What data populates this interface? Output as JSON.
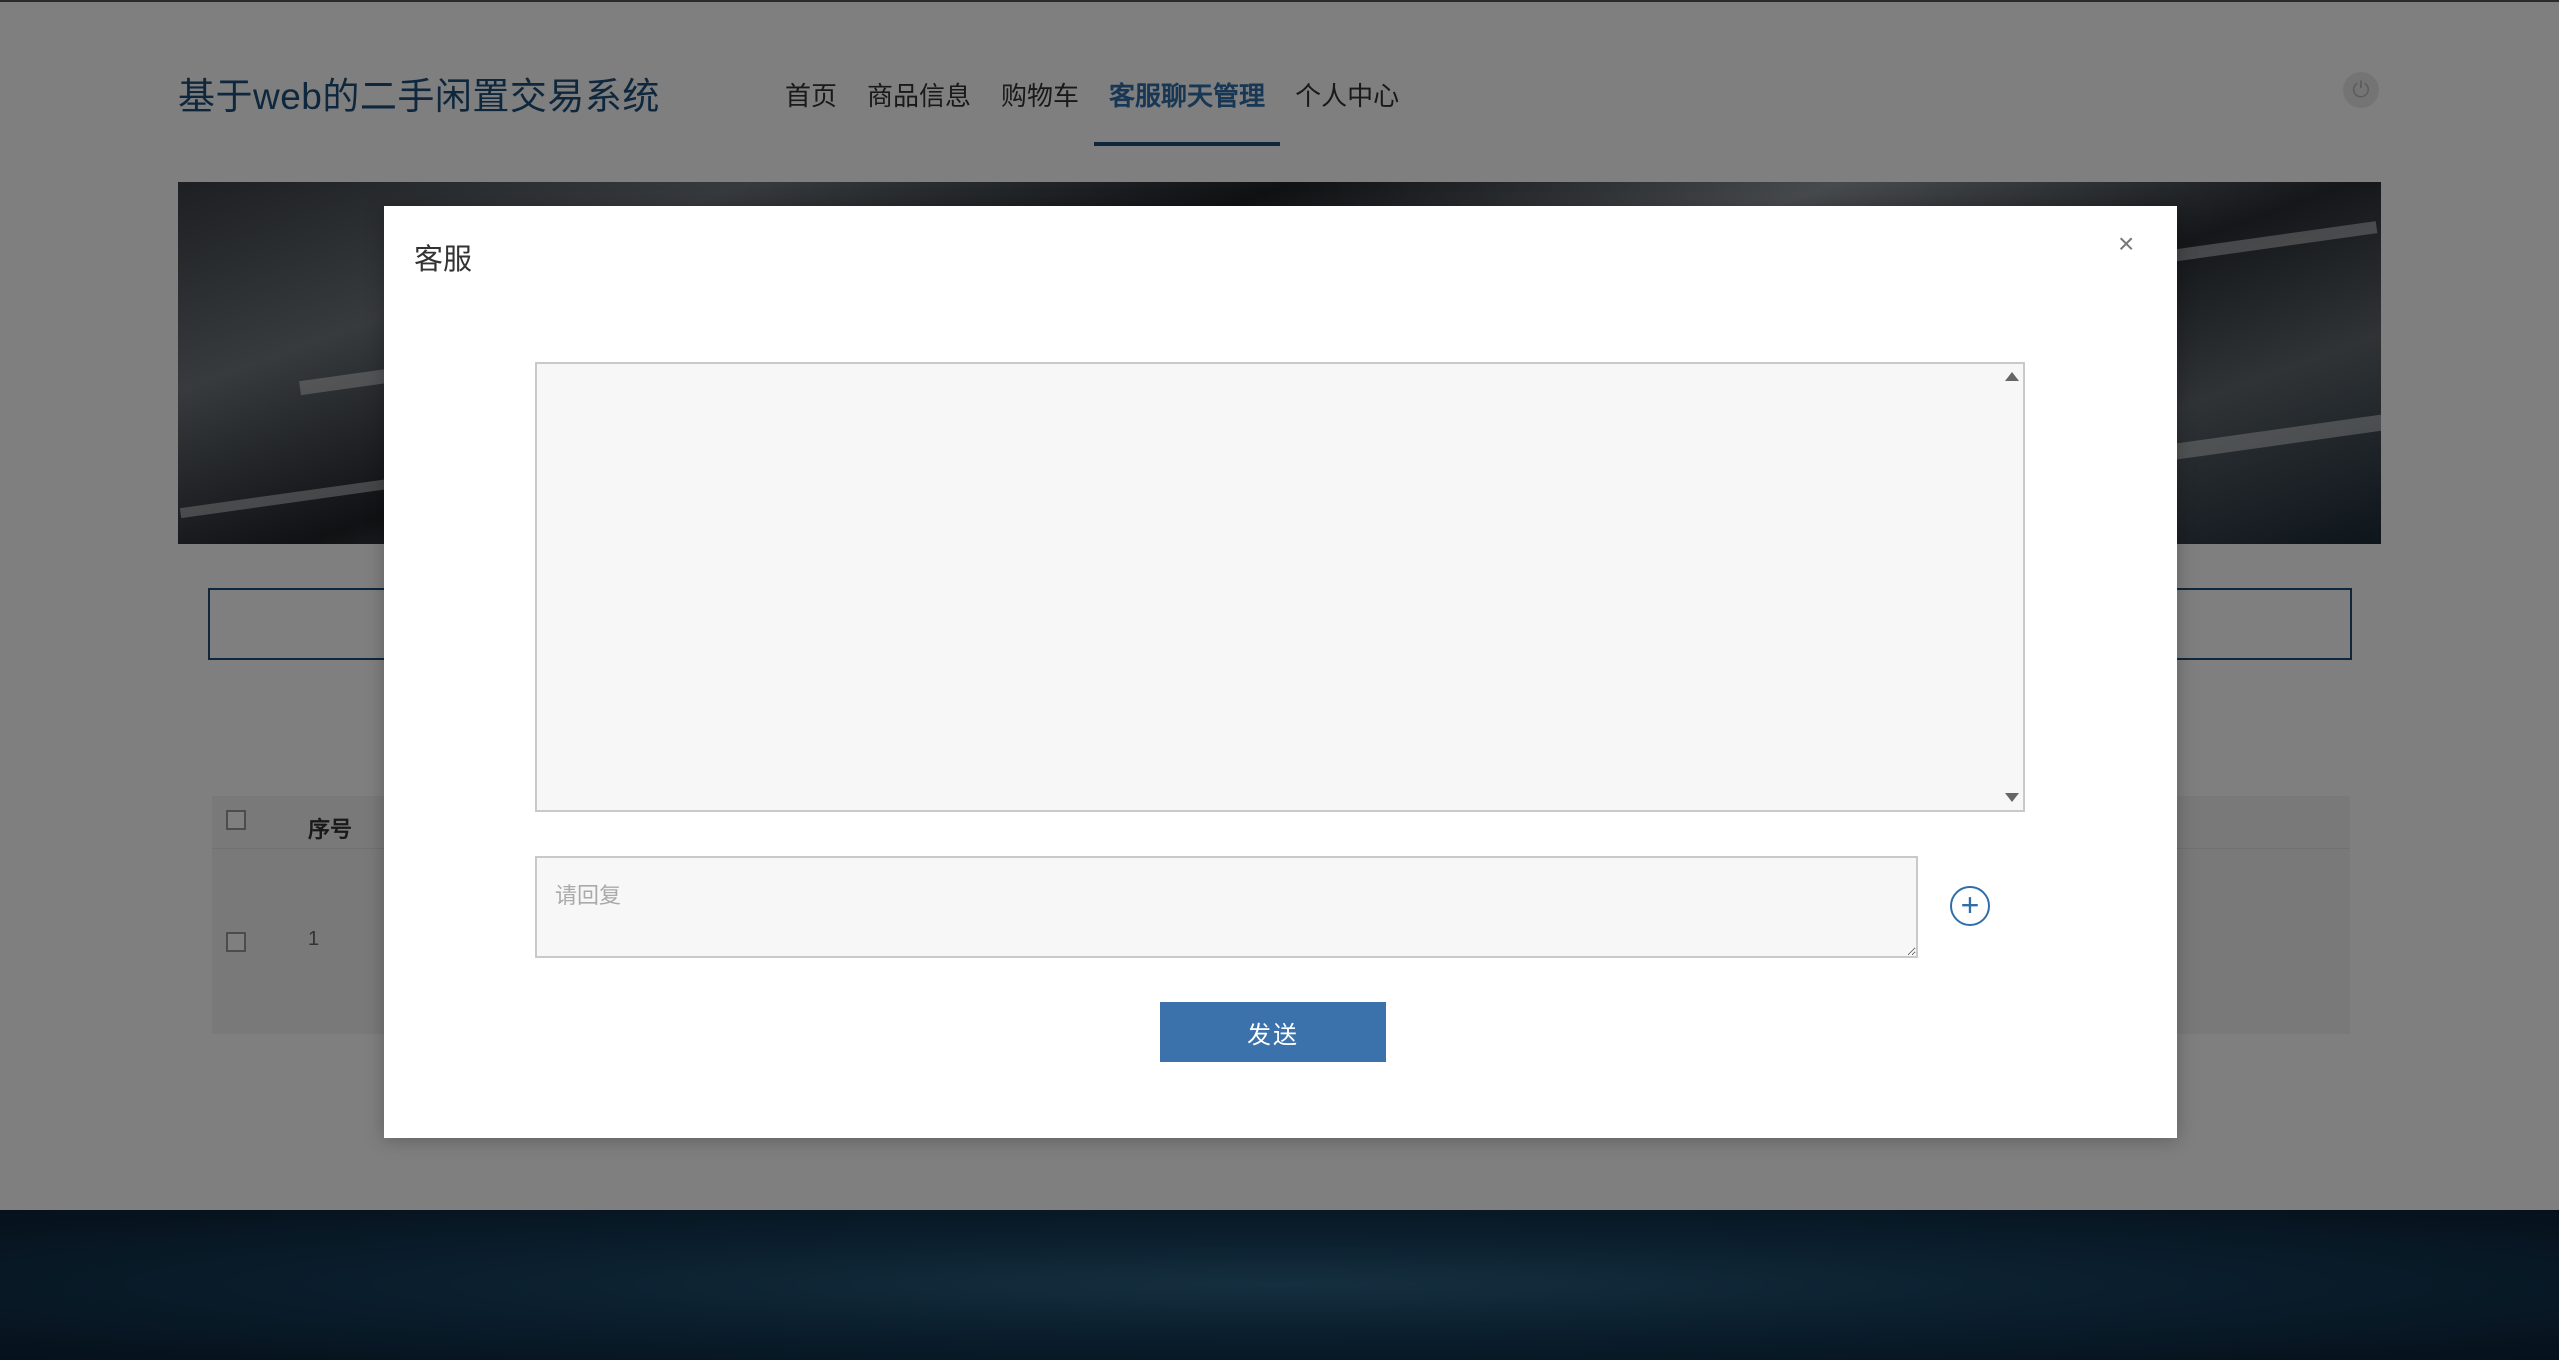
{
  "site": {
    "title": "基于web的二手闲置交易系统"
  },
  "nav": {
    "items": [
      {
        "label": "首页"
      },
      {
        "label": "商品信息"
      },
      {
        "label": "购物车"
      },
      {
        "label": "客服聊天管理"
      },
      {
        "label": "个人中心"
      }
    ],
    "active_index": 3
  },
  "header": {
    "power_icon": "power-icon"
  },
  "table": {
    "header_seq": "序号",
    "rows": [
      {
        "seq": "1"
      }
    ]
  },
  "modal": {
    "title": "客服",
    "close_glyph": "×",
    "reply_placeholder": "请回复",
    "plus_glyph": "+",
    "send_label": "发送"
  },
  "colors": {
    "accent": "#3c72ab",
    "title": "#1d4f7a",
    "footer": "#0b2237"
  }
}
